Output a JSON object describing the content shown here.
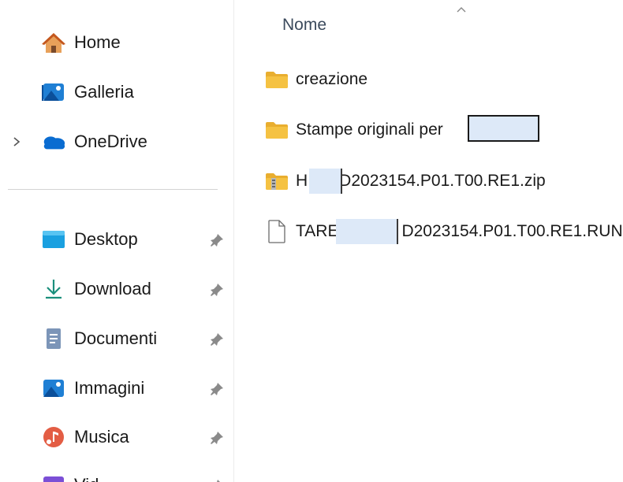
{
  "sidebar": {
    "items": [
      {
        "label": "Home",
        "icon": "home-icon"
      },
      {
        "label": "Galleria",
        "icon": "gallery-icon"
      },
      {
        "label": "OneDrive",
        "icon": "onedrive-cloud-icon",
        "expand_icon": "chevron-right-icon"
      },
      {
        "label": "Desktop",
        "icon": "desktop-icon",
        "pinned": true
      },
      {
        "label": "Download",
        "icon": "download-arrow-icon",
        "pinned": true
      },
      {
        "label": "Documenti",
        "icon": "document-icon",
        "pinned": true
      },
      {
        "label": "Immagini",
        "icon": "images-icon",
        "pinned": true
      },
      {
        "label": "Musica",
        "icon": "music-icon",
        "pinned": true
      },
      {
        "label": "Vid",
        "icon": "videos-icon",
        "pinned": true
      }
    ]
  },
  "list": {
    "column_header": "Nome",
    "sort_indicator": "chevron-up-icon",
    "files": [
      {
        "name": "creazione",
        "type": "folder",
        "icon": "folder-icon"
      },
      {
        "name": "Stampe originali per",
        "type": "folder",
        "icon": "folder-icon"
      },
      {
        "name_prefix": "H",
        "name_suffix": "D2023154.P01.T00.RE1.zip",
        "type": "zip",
        "icon": "zip-folder-icon"
      },
      {
        "name_prefix": "TARE",
        "name_suffix": "D2023154.P01.T00.RE1.RUN",
        "type": "file",
        "icon": "blank-file-icon"
      }
    ]
  },
  "colors": {
    "folder": "#f5c242",
    "onedrive": "#0a6cd1",
    "download": "#1b8f7c",
    "redaction_fill": "#dde9f8",
    "header_text": "#3b4a5c"
  }
}
